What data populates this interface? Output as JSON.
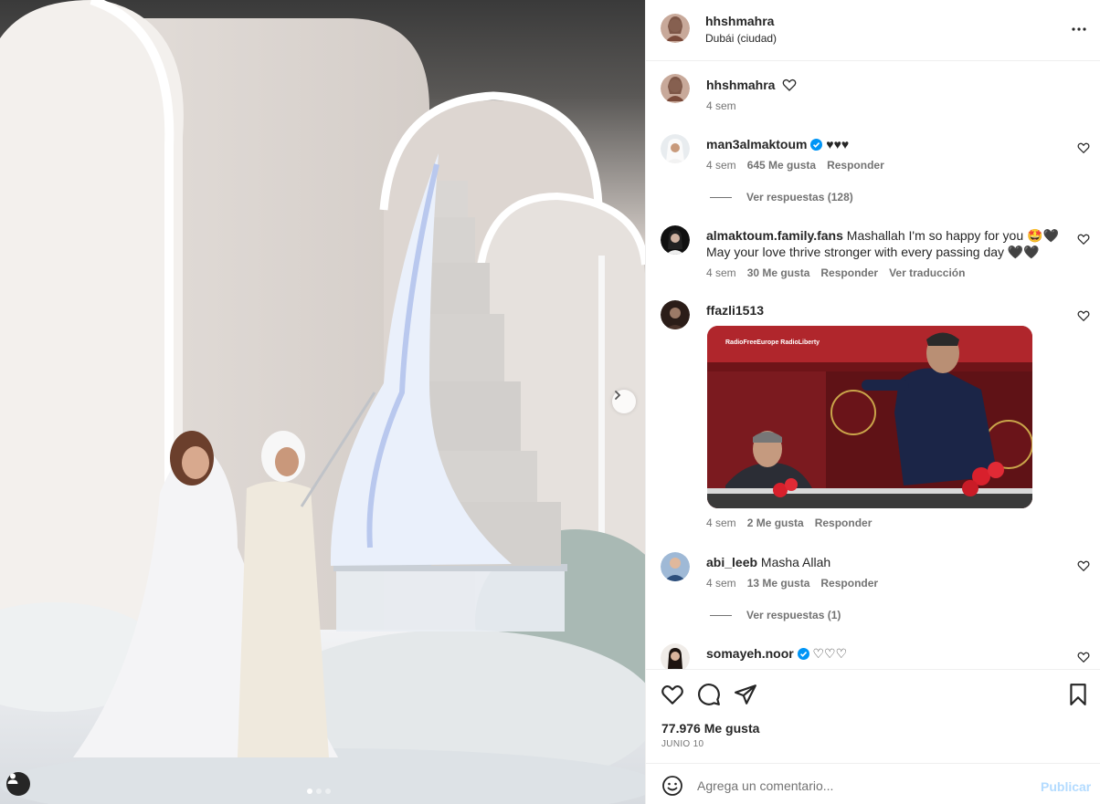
{
  "post": {
    "username": "hhshmahra",
    "location": "Dubái (ciudad)",
    "caption_time": "4 sem",
    "likes": "77.976 Me gusta",
    "date": "JUNIO 10",
    "carousel_total": 3,
    "carousel_current": 1
  },
  "comments": [
    {
      "user": "man3almaktoum",
      "verified": true,
      "text": "♥♥♥",
      "time": "4 sem",
      "likes": "645 Me gusta",
      "reply": "Responder",
      "view_replies": "Ver respuestas (128)"
    },
    {
      "user": "almaktoum.family.fans",
      "verified": false,
      "text": "Mashallah I'm so happy for you 🤩🖤",
      "text2": "May your love thrive stronger with every passing day 🖤🖤",
      "time": "4 sem",
      "likes": "30 Me gusta",
      "reply": "Responder",
      "translate": "Ver traducción"
    },
    {
      "user": "ffazli1513",
      "verified": false,
      "text": "",
      "gif_watermark": "RadioFreeEurope RadioLiberty",
      "time": "4 sem",
      "likes": "2 Me gusta",
      "reply": "Responder"
    },
    {
      "user": "abi_leeb",
      "verified": false,
      "text": "Masha Allah",
      "time": "4 sem",
      "likes": "13 Me gusta",
      "reply": "Responder",
      "view_replies": "Ver respuestas (1)"
    },
    {
      "user": "somayeh.noor",
      "verified": true,
      "text": "♡♡♡"
    }
  ],
  "composer": {
    "placeholder": "Agrega un comentario...",
    "publish": "Publicar"
  },
  "colors": {
    "verified": "#0095f6",
    "publish_disabled": "#b3dbff",
    "secondary_text": "#737373"
  }
}
